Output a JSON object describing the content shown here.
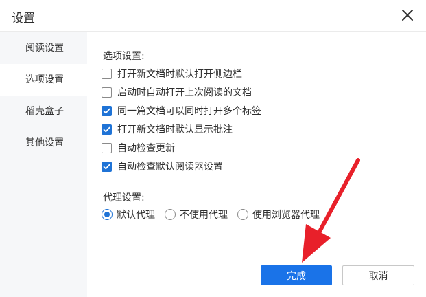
{
  "window": {
    "title": "设置"
  },
  "sidebar": {
    "items": [
      {
        "label": "阅读设置",
        "active": false
      },
      {
        "label": "选项设置",
        "active": true
      },
      {
        "label": "稻壳盒子",
        "active": false
      },
      {
        "label": "其他设置",
        "active": false
      }
    ]
  },
  "options": {
    "section_label": "选项设置:",
    "items": [
      {
        "label": "打开新文档时默认打开侧边栏",
        "checked": false
      },
      {
        "label": "启动时自动打开上次阅读的文档",
        "checked": false
      },
      {
        "label": "同一篇文档可以同时打开多个标签",
        "checked": true
      },
      {
        "label": "打开新文档时默认显示批注",
        "checked": true
      },
      {
        "label": "自动检查更新",
        "checked": false
      },
      {
        "label": "自动检查默认阅读器设置",
        "checked": true
      }
    ]
  },
  "proxy": {
    "section_label": "代理设置:",
    "options": [
      {
        "label": "默认代理",
        "selected": true
      },
      {
        "label": "不使用代理",
        "selected": false
      },
      {
        "label": "使用浏览器代理",
        "selected": false
      }
    ]
  },
  "buttons": {
    "ok_label": "完成",
    "cancel_label": "取消"
  },
  "colors": {
    "accent": "#1a73e8",
    "annotation_arrow": "#e8202a"
  },
  "icons": {
    "close": "close-icon",
    "checkmark": "checkmark-icon",
    "annotation": "arrow-annotation"
  }
}
